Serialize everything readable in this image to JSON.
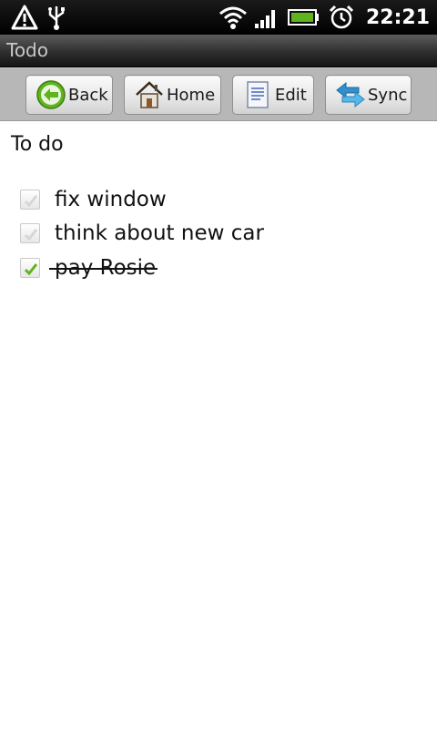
{
  "status_bar": {
    "time": "22:21",
    "icons": [
      "warning-icon",
      "usb-icon",
      "wifi-icon",
      "signal-icon",
      "battery-icon",
      "alarm-icon"
    ]
  },
  "title_bar": {
    "title": "Todo"
  },
  "toolbar": {
    "buttons": [
      {
        "label": "Back",
        "icon": "back-arrow-icon"
      },
      {
        "label": "Home",
        "icon": "home-icon"
      },
      {
        "label": "Edit",
        "icon": "edit-document-icon"
      },
      {
        "label": "Sync",
        "icon": "sync-arrows-icon"
      }
    ]
  },
  "main": {
    "heading": "To do",
    "items": [
      {
        "text": "fix window",
        "done": false
      },
      {
        "text": "think about new car",
        "done": false
      },
      {
        "text": "pay Rosie",
        "done": true
      }
    ]
  },
  "colors": {
    "check_green": "#5fb31c",
    "toolbar_bg": "#b7b7b7",
    "title_text": "#c9c9c9"
  }
}
